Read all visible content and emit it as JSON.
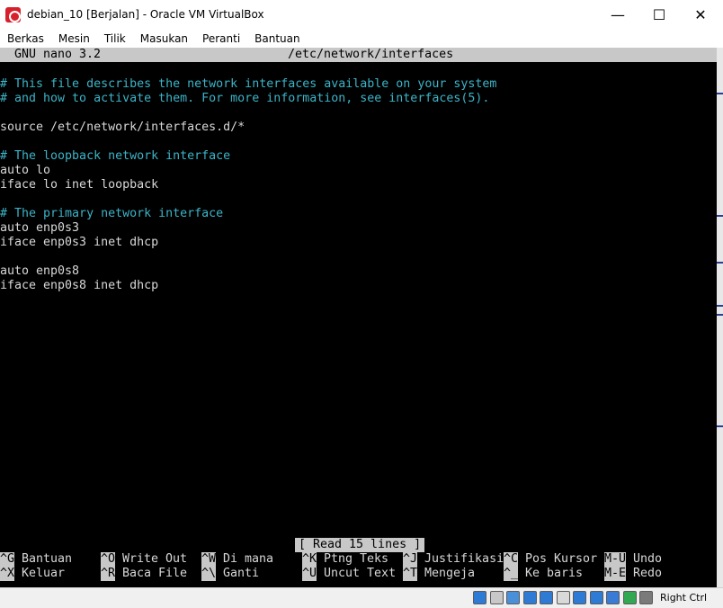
{
  "window": {
    "title": "debian_10 [Berjalan] - Oracle VM VirtualBox",
    "minimize_glyph": "—",
    "maximize_glyph": "☐",
    "close_glyph": "✕"
  },
  "menu": [
    "Berkas",
    "Mesin",
    "Tilik",
    "Masukan",
    "Peranti",
    "Bantuan"
  ],
  "nano": {
    "version": "GNU nano 3.2",
    "filename": "/etc/network/interfaces",
    "status_message": "[ Read 15 lines ]",
    "lines": [
      {
        "text": "",
        "type": "text"
      },
      {
        "text": "# This file describes the network interfaces available on your system",
        "type": "comment"
      },
      {
        "text": "# and how to activate them. For more information, see interfaces(5).",
        "type": "comment"
      },
      {
        "text": "",
        "type": "text"
      },
      {
        "text": "source /etc/network/interfaces.d/*",
        "type": "text"
      },
      {
        "text": "",
        "type": "text"
      },
      {
        "text": "# The loopback network interface",
        "type": "comment"
      },
      {
        "text": "auto lo",
        "type": "text"
      },
      {
        "text": "iface lo inet loopback",
        "type": "text"
      },
      {
        "text": "",
        "type": "text"
      },
      {
        "text": "# The primary network interface",
        "type": "comment"
      },
      {
        "text": "auto enp0s3",
        "type": "text"
      },
      {
        "text": "iface enp0s3 inet dhcp",
        "type": "text"
      },
      {
        "text": "",
        "type": "text"
      },
      {
        "text": "auto enp0s8",
        "type": "text"
      },
      {
        "text": "iface enp0s8 inet dhcp",
        "type": "text"
      }
    ],
    "shortcuts_row1": [
      {
        "key": "^G",
        "label": "Bantuan"
      },
      {
        "key": "^O",
        "label": "Write Out"
      },
      {
        "key": "^W",
        "label": "Di mana"
      },
      {
        "key": "^K",
        "label": "Ptng Teks"
      },
      {
        "key": "^J",
        "label": "Justifikasi"
      },
      {
        "key": "^C",
        "label": "Pos Kursor"
      },
      {
        "key": "M-U",
        "label": "Undo"
      }
    ],
    "shortcuts_row2": [
      {
        "key": "^X",
        "label": "Keluar"
      },
      {
        "key": "^R",
        "label": "Baca File"
      },
      {
        "key": "^\\",
        "label": "Ganti"
      },
      {
        "key": "^U",
        "label": "Uncut Text"
      },
      {
        "key": "^T",
        "label": "Mengeja"
      },
      {
        "key": "^_",
        "label": "Ke baris"
      },
      {
        "key": "M-E",
        "label": "Redo"
      }
    ]
  },
  "statusbar": {
    "host_key": "Right Ctrl",
    "icons": [
      "hard-disk-icon",
      "optical-drive-icon",
      "audio-icon",
      "network-icon",
      "usb-icon",
      "shared-folder-icon",
      "display-icon",
      "video-capture-icon",
      "guest-additions-icon",
      "mouse-integration-icon",
      "keyboard-icon"
    ]
  },
  "colors": {
    "terminal_bg": "#000000",
    "terminal_fg": "#d8d8d8",
    "comment": "#3cb4c8",
    "inverse_bg": "#c8c8c8",
    "app_icon": "#d6202c"
  }
}
